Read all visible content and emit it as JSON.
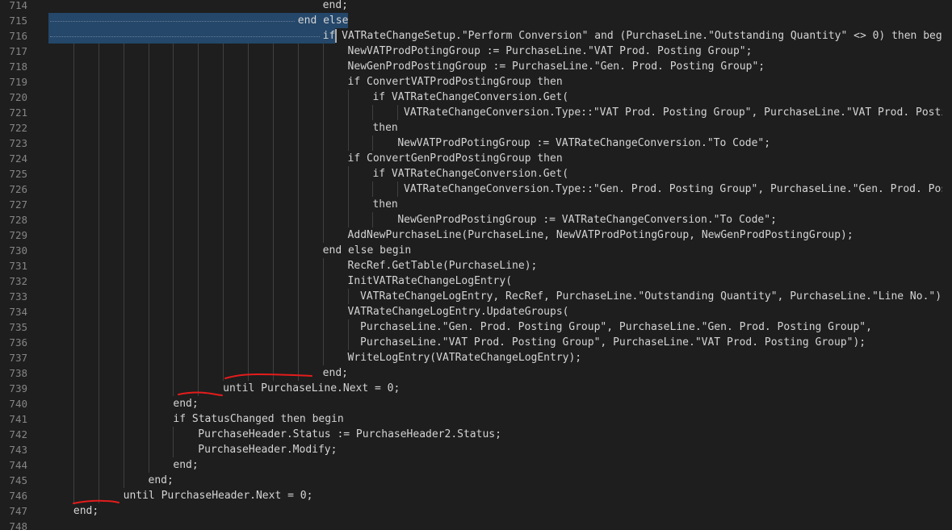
{
  "editor": {
    "first_line": 714,
    "lines": [
      {
        "n": "714",
        "indent": 44,
        "text": "end;"
      },
      {
        "n": "715",
        "indent": 40,
        "text": "end else"
      },
      {
        "n": "716",
        "indent": 44,
        "text": "if VATRateChangeSetup.\"Perform Conversion\" and (PurchaseLine.\"Outstanding Quantity\" <> 0) then begin"
      },
      {
        "n": "717",
        "indent": 48,
        "text": "NewVATProdPotingGroup := PurchaseLine.\"VAT Prod. Posting Group\";"
      },
      {
        "n": "718",
        "indent": 48,
        "text": "NewGenProdPostingGroup := PurchaseLine.\"Gen. Prod. Posting Group\";"
      },
      {
        "n": "719",
        "indent": 48,
        "text": "if ConvertVATProdPostingGroup then"
      },
      {
        "n": "720",
        "indent": 52,
        "text": "if VATRateChangeConversion.Get("
      },
      {
        "n": "721",
        "indent": 57,
        "text": "VATRateChangeConversion.Type::\"VAT Prod. Posting Group\", PurchaseLine.\"VAT Prod. Posting"
      },
      {
        "n": "722",
        "indent": 52,
        "text": "then"
      },
      {
        "n": "723",
        "indent": 56,
        "text": "NewVATProdPotingGroup := VATRateChangeConversion.\"To Code\";"
      },
      {
        "n": "724",
        "indent": 48,
        "text": "if ConvertGenProdPostingGroup then"
      },
      {
        "n": "725",
        "indent": 52,
        "text": "if VATRateChangeConversion.Get("
      },
      {
        "n": "726",
        "indent": 57,
        "text": "VATRateChangeConversion.Type::\"Gen. Prod. Posting Group\", PurchaseLine.\"Gen. Prod. Postin"
      },
      {
        "n": "727",
        "indent": 52,
        "text": "then"
      },
      {
        "n": "728",
        "indent": 56,
        "text": "NewGenProdPostingGroup := VATRateChangeConversion.\"To Code\";"
      },
      {
        "n": "729",
        "indent": 48,
        "text": "AddNewPurchaseLine(PurchaseLine, NewVATProdPotingGroup, NewGenProdPostingGroup);"
      },
      {
        "n": "730",
        "indent": 44,
        "text": "end else begin"
      },
      {
        "n": "731",
        "indent": 48,
        "text": "RecRef.GetTable(PurchaseLine);"
      },
      {
        "n": "732",
        "indent": 48,
        "text": "InitVATRateChangeLogEntry("
      },
      {
        "n": "733",
        "indent": 50,
        "text": "VATRateChangeLogEntry, RecRef, PurchaseLine.\"Outstanding Quantity\", PurchaseLine.\"Line No.\");"
      },
      {
        "n": "734",
        "indent": 48,
        "text": "VATRateChangeLogEntry.UpdateGroups("
      },
      {
        "n": "735",
        "indent": 50,
        "text": "PurchaseLine.\"Gen. Prod. Posting Group\", PurchaseLine.\"Gen. Prod. Posting Group\","
      },
      {
        "n": "736",
        "indent": 50,
        "text": "PurchaseLine.\"VAT Prod. Posting Group\", PurchaseLine.\"VAT Prod. Posting Group\");"
      },
      {
        "n": "737",
        "indent": 48,
        "text": "WriteLogEntry(VATRateChangeLogEntry);"
      },
      {
        "n": "738",
        "indent": 44,
        "text": "end;"
      },
      {
        "n": "739",
        "indent": 28,
        "text": "until PurchaseLine.Next = 0;"
      },
      {
        "n": "740",
        "indent": 20,
        "text": "end;"
      },
      {
        "n": "741",
        "indent": 20,
        "text": "if StatusChanged then begin"
      },
      {
        "n": "742",
        "indent": 24,
        "text": "PurchaseHeader.Status := PurchaseHeader2.Status;"
      },
      {
        "n": "743",
        "indent": 24,
        "text": "PurchaseHeader.Modify;"
      },
      {
        "n": "744",
        "indent": 20,
        "text": "end;"
      },
      {
        "n": "745",
        "indent": 16,
        "text": "end;"
      },
      {
        "n": "746",
        "indent": 12,
        "text": "until PurchaseHeader.Next = 0;"
      },
      {
        "n": "747",
        "indent": 4,
        "text": "end;"
      },
      {
        "n": "748",
        "indent": 0,
        "text": ""
      }
    ]
  },
  "colors": {
    "background": "#1e1e1e",
    "text": "#d4d4d4",
    "line_number": "#858585",
    "selection": "#264f78",
    "indent_guide": "#404040",
    "annotation": "#e51c1c"
  }
}
